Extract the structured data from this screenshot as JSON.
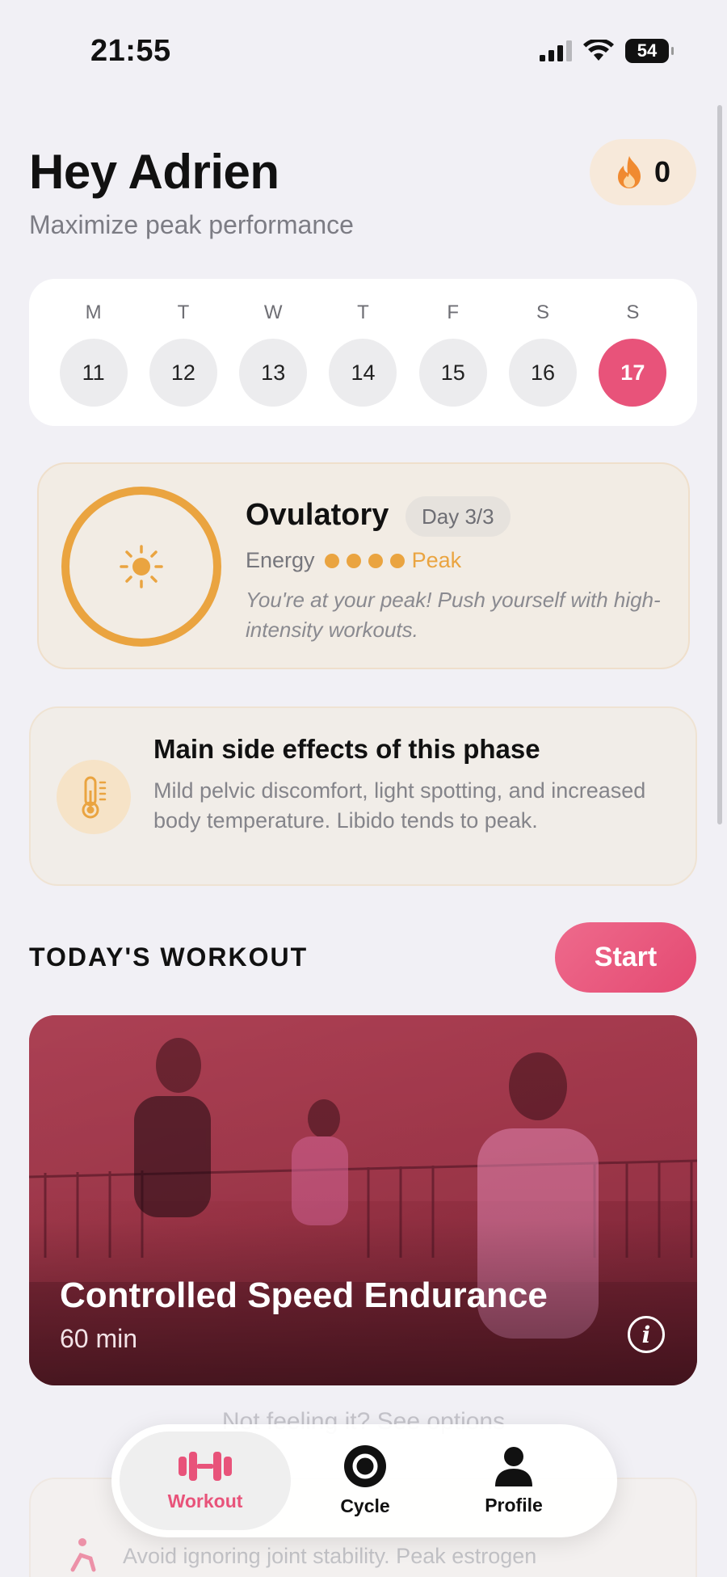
{
  "status_bar": {
    "time": "21:55",
    "battery": "54"
  },
  "header": {
    "greeting": "Hey Adrien",
    "subtitle": "Maximize peak performance",
    "streak_count": "0"
  },
  "week": {
    "days": [
      {
        "letter": "M",
        "date": "11"
      },
      {
        "letter": "T",
        "date": "12"
      },
      {
        "letter": "W",
        "date": "13"
      },
      {
        "letter": "T",
        "date": "14"
      },
      {
        "letter": "F",
        "date": "15"
      },
      {
        "letter": "S",
        "date": "16"
      },
      {
        "letter": "S",
        "date": "17"
      }
    ],
    "selected_index": 6
  },
  "phase": {
    "name": "Ovulatory",
    "day_badge": "Day 3/3",
    "energy_label": "Energy",
    "energy_dots": 4,
    "energy_level": "Peak",
    "description": "You're at your peak! Push yourself with high-intensity workouts."
  },
  "side_effects": {
    "title": "Main side effects of this phase",
    "description": "Mild pelvic discomfort, light spotting, and increased body temperature. Libido tends to peak."
  },
  "workout": {
    "section_title": "TODAY'S WORKOUT",
    "start_label": "Start",
    "title": "Controlled Speed Endurance",
    "duration": "60 min",
    "options_link": "Not feeling it? See options",
    "next_card_text": "Avoid ignoring joint stability. Peak estrogen"
  },
  "tabbar": {
    "tabs": [
      {
        "label": "Workout",
        "icon": "dumbbell-icon"
      },
      {
        "label": "Cycle",
        "icon": "cycle-ring-icon"
      },
      {
        "label": "Profile",
        "icon": "person-icon"
      }
    ],
    "active_index": 0
  },
  "colors": {
    "accent": "#e8537a",
    "phase": "#eaa440",
    "streak_bg": "#f7e9da",
    "flame": "#f08a30"
  }
}
